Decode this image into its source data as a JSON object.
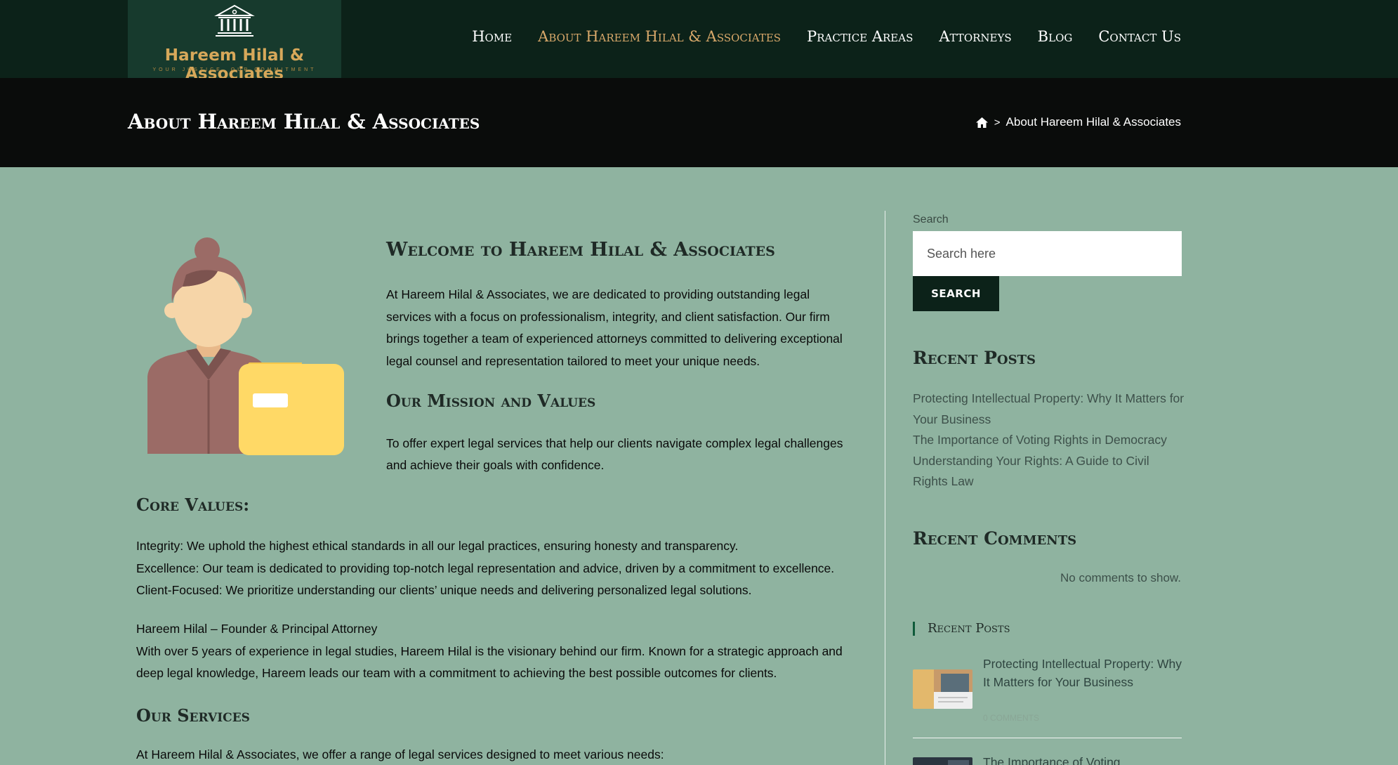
{
  "header": {
    "logo": {
      "name": "Hareem Hilal & Associates",
      "tagline": "YOUR JUSTICE, OUR COMMITMENT"
    },
    "nav": [
      {
        "label": "Home",
        "active": false
      },
      {
        "label": "About Hareem Hilal & Associates",
        "active": true
      },
      {
        "label": "Practice Areas",
        "active": false
      },
      {
        "label": "Attorneys",
        "active": false
      },
      {
        "label": "Blog",
        "active": false
      },
      {
        "label": "Contact Us",
        "active": false
      }
    ]
  },
  "page_header": {
    "title": "About Hareem Hilal & Associates",
    "breadcrumb": {
      "home_icon": "home-icon",
      "separator": ">",
      "current": "About Hareem Hilal & Associates"
    }
  },
  "main": {
    "welcome_heading": "Welcome to Hareem Hilal & Associates",
    "intro": "At Hareem Hilal & Associates, we are dedicated to providing outstanding legal services with a focus on professionalism, integrity, and client satisfaction. Our firm brings together a team of experienced attorneys committed to delivering exceptional legal counsel and representation tailored to meet your unique needs.",
    "mission_heading": "Our Mission and Values",
    "mission_text": "To offer expert legal services that help our clients navigate complex legal challenges and achieve their goals with confidence.",
    "core_heading": "Core Values:",
    "core_values": [
      "Integrity: We uphold the highest ethical standards in all our legal practices, ensuring honesty and transparency.",
      "Excellence: Our team is dedicated to providing top-notch legal representation and advice, driven by a commitment to excellence.",
      "Client-Focused: We prioritize understanding our clients’ unique needs and delivering personalized legal solutions."
    ],
    "founder_title": "Hareem Hilal – Founder & Principal Attorney",
    "founder_bio": "With over 5 years of experience in legal studies, Hareem Hilal is the visionary behind our firm. Known for a strategic approach and deep legal knowledge, Hareem leads our team with a commitment to achieving the best possible outcomes for clients.",
    "services_heading": "Our Services",
    "services_intro": "At Hareem Hilal & Associates, we offer a range of legal services designed to meet various needs:"
  },
  "sidebar": {
    "search_label": "Search",
    "search_placeholder": "Search here",
    "search_button": "SEARCH",
    "recent_posts_heading": "Recent Posts",
    "recent_posts": [
      "Protecting Intellectual Property: Why It Matters for Your Business",
      "The Importance of Voting Rights in Democracy",
      "Understanding Your Rights: A Guide to Civil Rights Law"
    ],
    "recent_comments_heading": "Recent Comments",
    "no_comments": "No comments to show.",
    "widget_heading": "Recent Posts",
    "widget_posts": [
      {
        "title": "Protecting Intellectual Property: Why It Matters for Your Business",
        "meta": "0 COMMENTS"
      },
      {
        "title": "The Importance of Voting"
      }
    ]
  },
  "colors": {
    "header_bg": "#0c2219",
    "accent": "#d8a86a",
    "content_bg": "#8fb3a0",
    "button_bg": "#0c2219"
  }
}
